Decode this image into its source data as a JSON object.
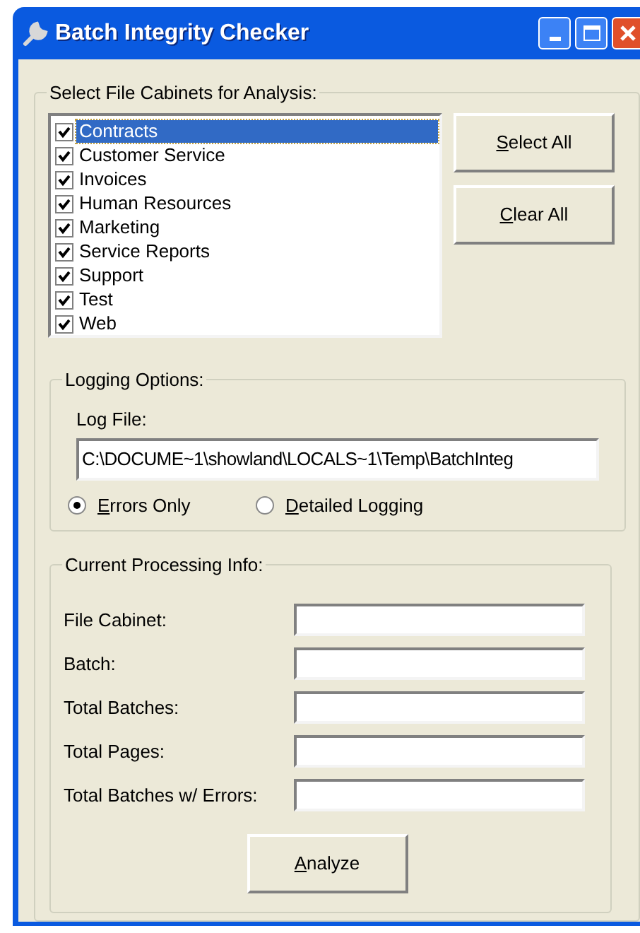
{
  "window": {
    "title": "Batch Integrity Checker"
  },
  "cabinets": {
    "legend": "Select File Cabinets for Analysis:",
    "items": [
      {
        "label": "Contracts",
        "checked": true,
        "selected": true
      },
      {
        "label": "Customer Service",
        "checked": true,
        "selected": false
      },
      {
        "label": "Invoices",
        "checked": true,
        "selected": false
      },
      {
        "label": "Human Resources",
        "checked": true,
        "selected": false
      },
      {
        "label": "Marketing",
        "checked": true,
        "selected": false
      },
      {
        "label": "Service Reports",
        "checked": true,
        "selected": false
      },
      {
        "label": "Support",
        "checked": true,
        "selected": false
      },
      {
        "label": "Test",
        "checked": true,
        "selected": false
      },
      {
        "label": "Web",
        "checked": true,
        "selected": false
      }
    ],
    "buttons": [
      "Select All",
      "Clear All"
    ]
  },
  "logging": {
    "legend": "Logging Options:",
    "log_file_label": "Log File:",
    "log_file": "C:\\DOCUME~1\\showland\\LOCALS~1\\Temp\\BatchInteg",
    "options": [
      {
        "label": "Errors Only",
        "selected": true
      },
      {
        "label": "Detailed Logging",
        "selected": false
      }
    ]
  },
  "processing": {
    "legend": "Current Processing Info:",
    "fields": [
      {
        "label": "File Cabinet:"
      },
      {
        "label": "Batch:"
      },
      {
        "label": "Total Batches:"
      },
      {
        "label": "Total Pages:"
      },
      {
        "label": "Total Batches w/ Errors:"
      }
    ],
    "button": "Analyze"
  }
}
